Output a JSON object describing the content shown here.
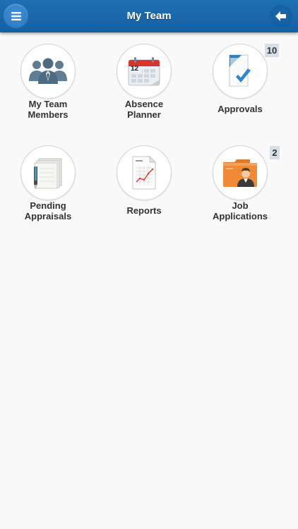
{
  "header": {
    "title": "My Team",
    "menu_icon": "hamburger-menu-icon",
    "back_icon": "arrow-left-icon",
    "color": "#1765a9"
  },
  "tiles": [
    {
      "label": "My Team\nMembers",
      "icon": "team-people-icon"
    },
    {
      "label": "Absence\nPlanner",
      "icon": "calendar-icon",
      "calendar_day": "12"
    },
    {
      "label": "Approvals",
      "icon": "document-check-icon",
      "badge": "10"
    },
    {
      "label": "Pending\nAppraisals",
      "icon": "notepad-pen-icon"
    },
    {
      "label": "Reports",
      "icon": "report-chart-icon"
    },
    {
      "label": "Job\nApplications",
      "icon": "folder-person-icon",
      "badge": "2"
    }
  ]
}
